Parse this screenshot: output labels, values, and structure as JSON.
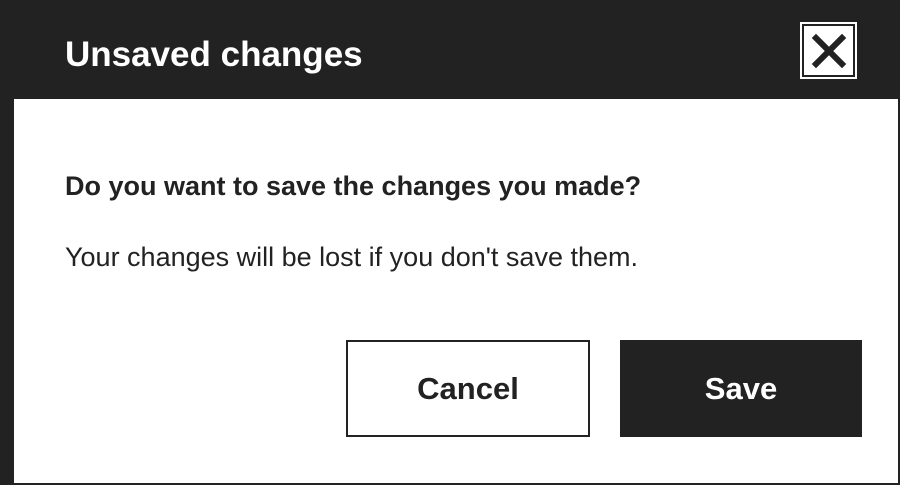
{
  "dialog": {
    "title": "Unsaved changes",
    "close_icon": "close-icon",
    "question": "Do you want to save the changes you made?",
    "message": "Your changes will be lost if you don't save them.",
    "buttons": {
      "cancel_label": "Cancel",
      "save_label": "Save"
    }
  },
  "colors": {
    "header_background": "#222222",
    "primary_button": "#222222",
    "text": "#222222",
    "background": "#ffffff"
  }
}
